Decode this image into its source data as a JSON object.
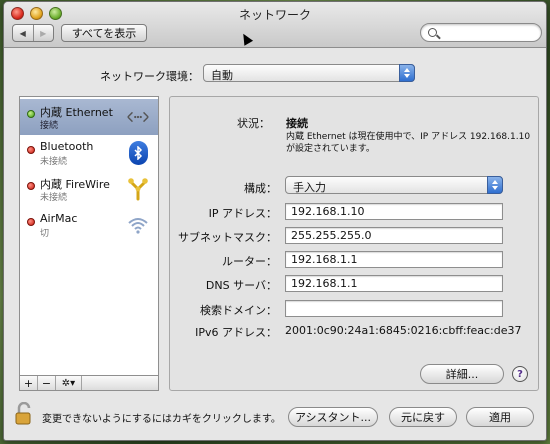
{
  "window": {
    "title": "ネットワーク",
    "show_all": "すべてを表示",
    "back_icon": "◀",
    "forward_icon": "▶"
  },
  "location": {
    "label": "ネットワーク環境：",
    "value": "自動"
  },
  "services": [
    {
      "name": "内蔵 Ethernet",
      "status": "接続",
      "indicator": "green",
      "icon": "ethernet-icon"
    },
    {
      "name": "Bluetooth",
      "status": "未接続",
      "indicator": "red",
      "icon": "bluetooth-icon"
    },
    {
      "name": "内蔵 FireWire",
      "status": "未接続",
      "indicator": "red",
      "icon": "firewire-icon"
    },
    {
      "name": "AirMac",
      "status": "切",
      "indicator": "red",
      "icon": "wifi-icon"
    }
  ],
  "list_footer": {
    "add": "+",
    "remove": "−",
    "gear": "✲▾"
  },
  "detail": {
    "status_label": "状況：",
    "status_value": "接続",
    "status_desc": "内蔵 Ethernet は現在使用中で、IP アドレス 192.168.1.10 が設定されています。",
    "config_label": "構成：",
    "config_value": "手入力",
    "ip_label": "IP アドレス：",
    "ip_value": "192.168.1.10",
    "subnet_label": "サブネットマスク：",
    "subnet_value": "255.255.255.0",
    "router_label": "ルーター：",
    "router_value": "192.168.1.1",
    "dns_label": "DNS サーバ：",
    "dns_value": "192.168.1.1",
    "search_domain_label": "検索ドメイン：",
    "search_domain_value": "",
    "ipv6_label": "IPv6 アドレス：",
    "ipv6_value": "2001:0c90:24a1:6845:0216:cbff:feac:de37",
    "advanced_button": "詳細...",
    "help_button": "?"
  },
  "footer": {
    "lock_text": "変更できないようにするにはカギをクリックします。",
    "assistant_button": "アシスタント...",
    "revert_button": "元に戻す",
    "apply_button": "適用"
  },
  "colors": {
    "selection": "#9aaac8",
    "accent": "#2f6fd0"
  }
}
